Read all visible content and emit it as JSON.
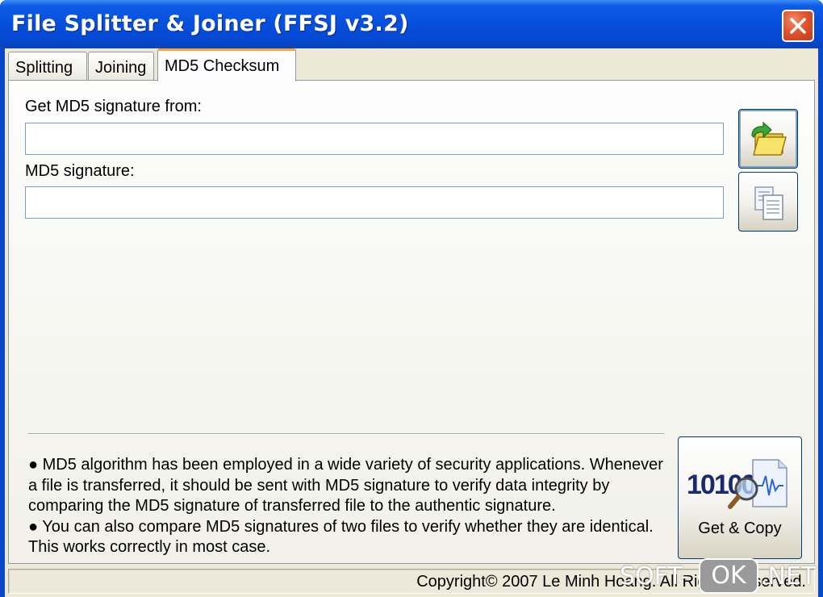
{
  "window": {
    "title": "File Splitter & Joiner (FFSJ v3.2)",
    "close_icon": "close-icon"
  },
  "tabs": [
    {
      "label": "Splitting",
      "active": false
    },
    {
      "label": "Joining",
      "active": false
    },
    {
      "label": "MD5 Checksum",
      "active": true
    }
  ],
  "form": {
    "source_label": "Get MD5 signature from:",
    "source_value": "",
    "signature_label": "MD5 signature:",
    "signature_value": ""
  },
  "side_buttons": {
    "browse_icon": "folder-open-icon",
    "copy_icon": "copy-icon"
  },
  "info": {
    "bullet1": "● MD5 algorithm has been employed in a wide variety of security applications. Whenever a file is transferred, it should be sent with MD5 signature to verify data integrity by comparing the MD5 signature of transferred file to the authentic signature.",
    "bullet2": "● You can also compare MD5 signatures of two files to verify whether they are identical. This works correctly in most case."
  },
  "action": {
    "label": "Get & Copy",
    "icon_digits": "10100"
  },
  "status": {
    "copyright": "Copyright© 2007 Le Minh Hoang. All Rights Reserved."
  },
  "watermark": {
    "part1": "SOFT-",
    "part2": "OK",
    "part3": ".NET"
  },
  "colors": {
    "titlebar": "#0650df",
    "close_button": "#e0542f",
    "active_tab_accent": "#f4a53a"
  }
}
